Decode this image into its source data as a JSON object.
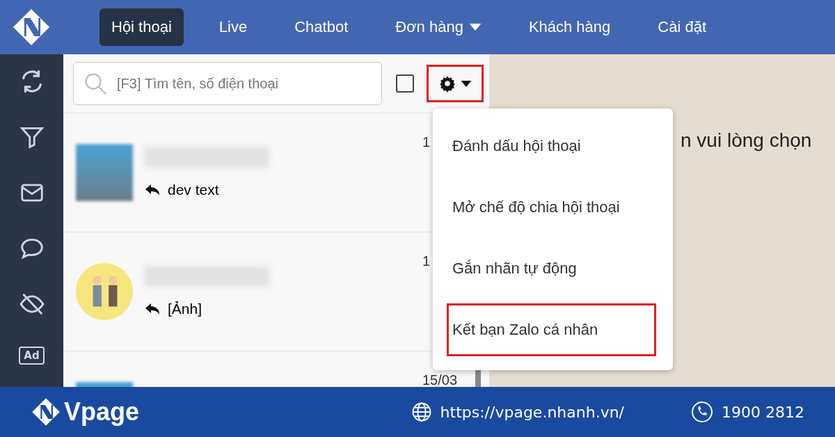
{
  "nav": {
    "tabs": [
      {
        "label": "Hội thoại",
        "selected": true,
        "dropdown": false
      },
      {
        "label": "Live",
        "selected": false,
        "dropdown": false
      },
      {
        "label": "Chatbot",
        "selected": false,
        "dropdown": false
      },
      {
        "label": "Đơn hàng",
        "selected": false,
        "dropdown": true
      },
      {
        "label": "Khách hàng",
        "selected": false,
        "dropdown": false
      },
      {
        "label": "Cài đặt",
        "selected": false,
        "dropdown": false
      }
    ]
  },
  "sidebar": {
    "items": [
      {
        "kind": "refresh"
      },
      {
        "kind": "filter"
      },
      {
        "kind": "mail"
      },
      {
        "kind": "chat"
      },
      {
        "kind": "hidden"
      },
      {
        "kind": "ad",
        "label": "Ad"
      }
    ]
  },
  "search": {
    "placeholder": "[F3] Tìm tên, số điện thoại"
  },
  "select_all": {
    "checked": false
  },
  "settings_button": {
    "highlighted": true
  },
  "conversations": [
    {
      "kind": "photo",
      "preview": "dev text",
      "time": "1"
    },
    {
      "kind": "cartoon",
      "preview": "[Ảnh]",
      "time": "1"
    },
    {
      "kind": "photo",
      "time": "15/03"
    }
  ],
  "menu": {
    "items": [
      {
        "label": "Đánh dấu hội thoại",
        "highlighted": false
      },
      {
        "label": "Mở chế độ chia hội thoại",
        "highlighted": false
      },
      {
        "label": "Gắn nhãn tự động",
        "highlighted": false
      },
      {
        "label": "Kết bạn Zalo cá nhân",
        "highlighted": true
      }
    ]
  },
  "main": {
    "message": "n vui lòng chọn"
  },
  "footer": {
    "brand": "Vpage",
    "website": "https://vpage.nhanh.vn/",
    "phone": "1900 2812"
  }
}
